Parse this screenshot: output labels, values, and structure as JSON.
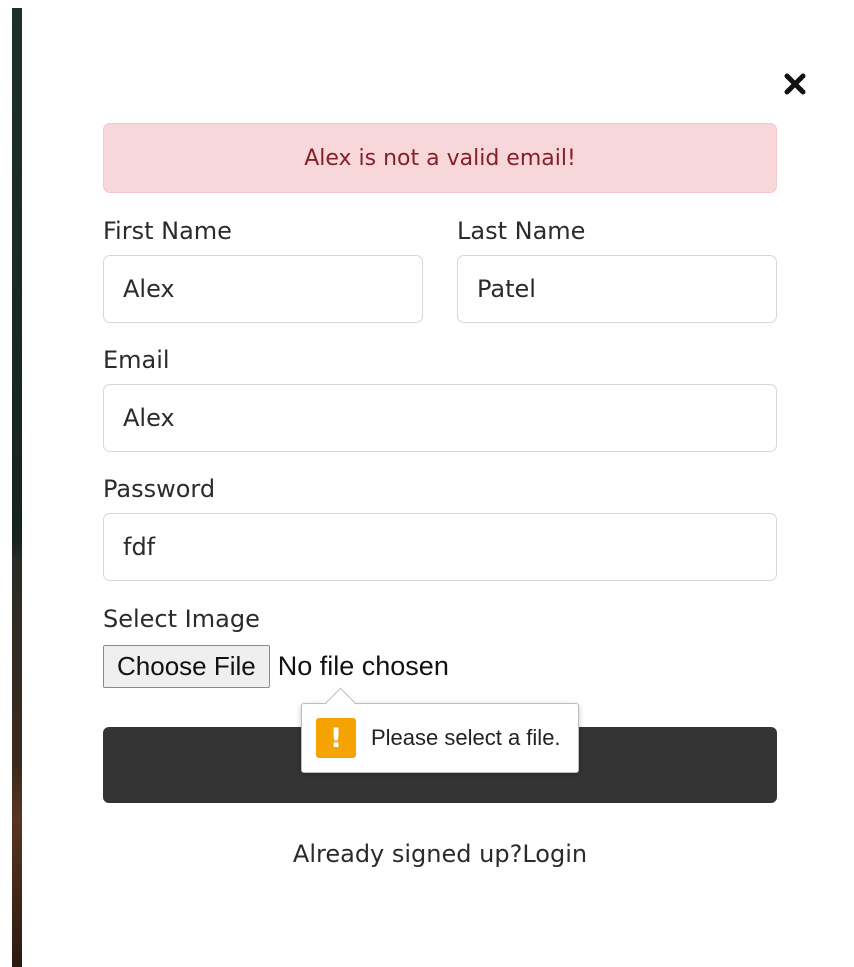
{
  "alert": {
    "message": "Alex is not a valid email!"
  },
  "form": {
    "first_name": {
      "label": "First Name",
      "value": "Alex"
    },
    "last_name": {
      "label": "Last Name",
      "value": "Patel"
    },
    "email": {
      "label": "Email",
      "value": "Alex"
    },
    "password": {
      "label": "Password",
      "value": "fdf"
    },
    "image": {
      "label": "Select Image",
      "button_label": "Choose File",
      "status": "No file chosen"
    }
  },
  "validation_tooltip": {
    "icon": "warning-icon",
    "symbol": "!",
    "message": "Please select a file."
  },
  "footer": {
    "prompt": "Already signed up?",
    "link": "Login"
  },
  "icons": {
    "close": "close-icon"
  },
  "colors": {
    "alert_background": "#f8d7da",
    "alert_text": "#842029",
    "submit_background": "#343434",
    "warning": "#f5a300"
  }
}
